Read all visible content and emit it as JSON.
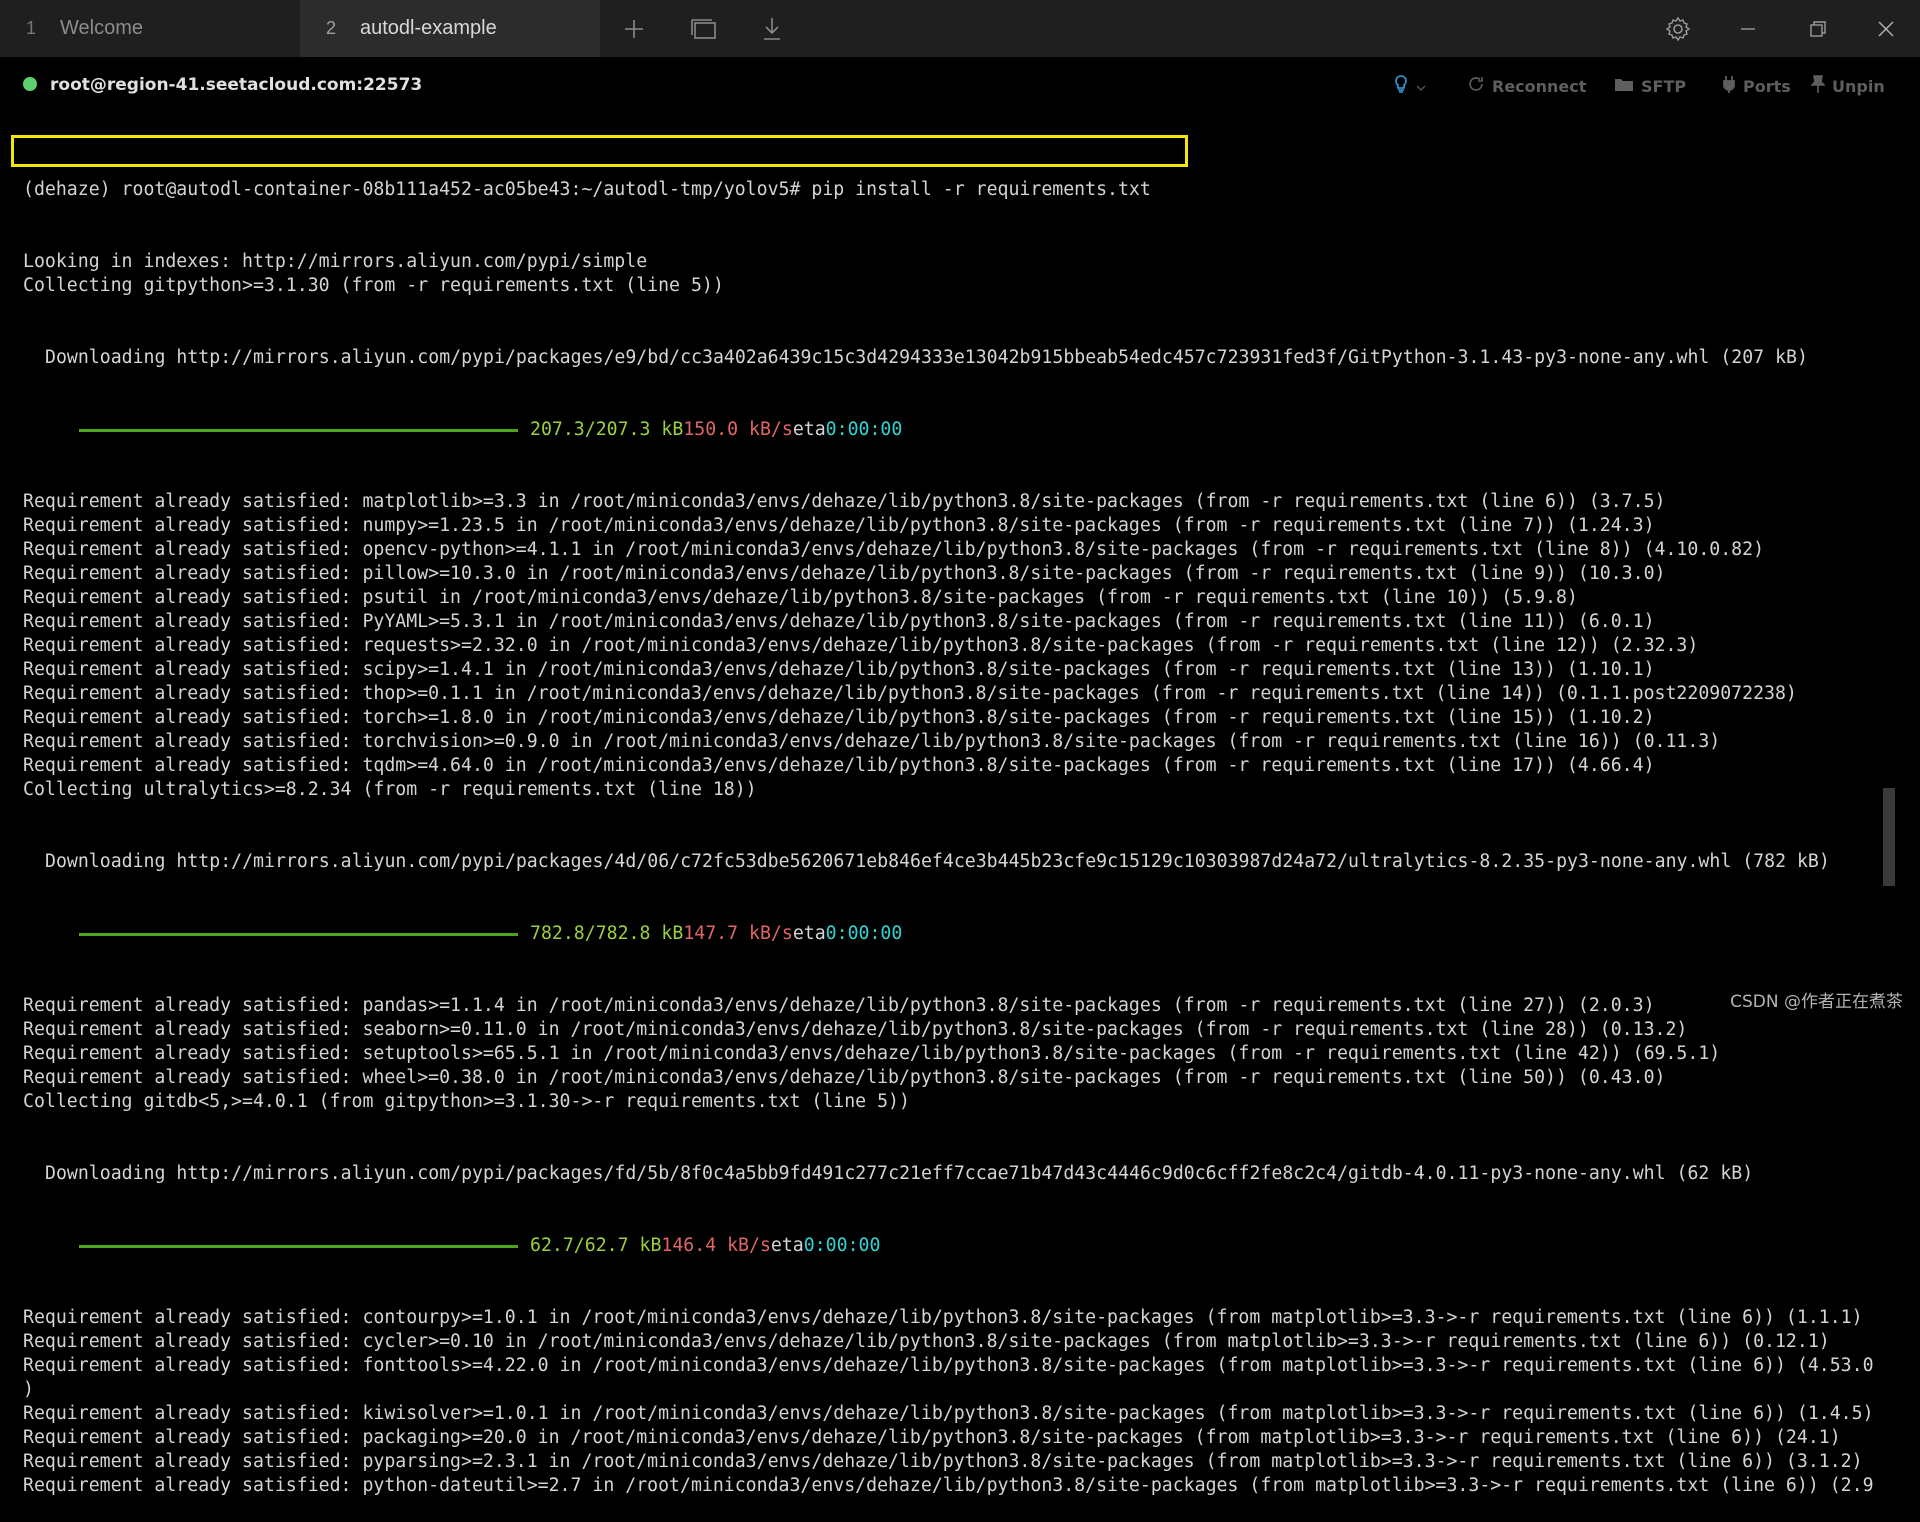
{
  "tabs": [
    {
      "number": "1",
      "label": "Welcome"
    },
    {
      "number": "2",
      "label": "autodl-example"
    }
  ],
  "session": {
    "host": "root@region-41.seetacloud.com:22573",
    "buttons": {
      "reconnect": "Reconnect",
      "sftp": "SFTP",
      "ports": "Ports",
      "unpin": "Unpin"
    }
  },
  "terminal": {
    "command": "(dehaze) root@autodl-container-08b111a452-ac05be43:~/autodl-tmp/yolov5# pip install -r requirements.txt",
    "lines_a": [
      "Looking in indexes: http://mirrors.aliyun.com/pypi/simple",
      "Collecting gitpython>=3.1.30 (from -r requirements.txt (line 5))"
    ],
    "download_1": "Downloading http://mirrors.aliyun.com/pypi/packages/e9/bd/cc3a402a6439c15c3d4294333e13042b915bbeab54edc457c723931fed3f/GitPython-3.1.43-py3-none-any.whl (207 kB)",
    "progress_1": {
      "size": "207.3/207.3 kB",
      "speed": "150.0 kB/s",
      "eta_label": "eta",
      "eta": "0:00:00"
    },
    "lines_b": [
      "Requirement already satisfied: matplotlib>=3.3 in /root/miniconda3/envs/dehaze/lib/python3.8/site-packages (from -r requirements.txt (line 6)) (3.7.5)",
      "Requirement already satisfied: numpy>=1.23.5 in /root/miniconda3/envs/dehaze/lib/python3.8/site-packages (from -r requirements.txt (line 7)) (1.24.3)",
      "Requirement already satisfied: opencv-python>=4.1.1 in /root/miniconda3/envs/dehaze/lib/python3.8/site-packages (from -r requirements.txt (line 8)) (4.10.0.82)",
      "Requirement already satisfied: pillow>=10.3.0 in /root/miniconda3/envs/dehaze/lib/python3.8/site-packages (from -r requirements.txt (line 9)) (10.3.0)",
      "Requirement already satisfied: psutil in /root/miniconda3/envs/dehaze/lib/python3.8/site-packages (from -r requirements.txt (line 10)) (5.9.8)",
      "Requirement already satisfied: PyYAML>=5.3.1 in /root/miniconda3/envs/dehaze/lib/python3.8/site-packages (from -r requirements.txt (line 11)) (6.0.1)",
      "Requirement already satisfied: requests>=2.32.0 in /root/miniconda3/envs/dehaze/lib/python3.8/site-packages (from -r requirements.txt (line 12)) (2.32.3)",
      "Requirement already satisfied: scipy>=1.4.1 in /root/miniconda3/envs/dehaze/lib/python3.8/site-packages (from -r requirements.txt (line 13)) (1.10.1)",
      "Requirement already satisfied: thop>=0.1.1 in /root/miniconda3/envs/dehaze/lib/python3.8/site-packages (from -r requirements.txt (line 14)) (0.1.1.post2209072238)",
      "Requirement already satisfied: torch>=1.8.0 in /root/miniconda3/envs/dehaze/lib/python3.8/site-packages (from -r requirements.txt (line 15)) (1.10.2)",
      "Requirement already satisfied: torchvision>=0.9.0 in /root/miniconda3/envs/dehaze/lib/python3.8/site-packages (from -r requirements.txt (line 16)) (0.11.3)",
      "Requirement already satisfied: tqdm>=4.64.0 in /root/miniconda3/envs/dehaze/lib/python3.8/site-packages (from -r requirements.txt (line 17)) (4.66.4)",
      "Collecting ultralytics>=8.2.34 (from -r requirements.txt (line 18))"
    ],
    "download_2": "Downloading http://mirrors.aliyun.com/pypi/packages/4d/06/c72fc53dbe5620671eb846ef4ce3b445b23cfe9c15129c10303987d24a72/ultralytics-8.2.35-py3-none-any.whl (782 kB)",
    "progress_2": {
      "size": "782.8/782.8 kB",
      "speed": "147.7 kB/s",
      "eta_label": "eta",
      "eta": "0:00:00"
    },
    "lines_c": [
      "Requirement already satisfied: pandas>=1.1.4 in /root/miniconda3/envs/dehaze/lib/python3.8/site-packages (from -r requirements.txt (line 27)) (2.0.3)",
      "Requirement already satisfied: seaborn>=0.11.0 in /root/miniconda3/envs/dehaze/lib/python3.8/site-packages (from -r requirements.txt (line 28)) (0.13.2)",
      "Requirement already satisfied: setuptools>=65.5.1 in /root/miniconda3/envs/dehaze/lib/python3.8/site-packages (from -r requirements.txt (line 42)) (69.5.1)",
      "Requirement already satisfied: wheel>=0.38.0 in /root/miniconda3/envs/dehaze/lib/python3.8/site-packages (from -r requirements.txt (line 50)) (0.43.0)",
      "Collecting gitdb<5,>=4.0.1 (from gitpython>=3.1.30->-r requirements.txt (line 5))"
    ],
    "download_3": "Downloading http://mirrors.aliyun.com/pypi/packages/fd/5b/8f0c4a5bb9fd491c277c21eff7ccae71b47d43c4446c9d0c6cff2fe8c2c4/gitdb-4.0.11-py3-none-any.whl (62 kB)",
    "progress_3": {
      "size": "62.7/62.7 kB",
      "speed": "146.4 kB/s",
      "eta_label": "eta",
      "eta": "0:00:00"
    },
    "lines_d": [
      "Requirement already satisfied: contourpy>=1.0.1 in /root/miniconda3/envs/dehaze/lib/python3.8/site-packages (from matplotlib>=3.3->-r requirements.txt (line 6)) (1.1.1)",
      "Requirement already satisfied: cycler>=0.10 in /root/miniconda3/envs/dehaze/lib/python3.8/site-packages (from matplotlib>=3.3->-r requirements.txt (line 6)) (0.12.1)",
      "Requirement already satisfied: fonttools>=4.22.0 in /root/miniconda3/envs/dehaze/lib/python3.8/site-packages (from matplotlib>=3.3->-r requirements.txt (line 6)) (4.53.0",
      ")",
      "Requirement already satisfied: kiwisolver>=1.0.1 in /root/miniconda3/envs/dehaze/lib/python3.8/site-packages (from matplotlib>=3.3->-r requirements.txt (line 6)) (1.4.5)",
      "Requirement already satisfied: packaging>=20.0 in /root/miniconda3/envs/dehaze/lib/python3.8/site-packages (from matplotlib>=3.3->-r requirements.txt (line 6)) (24.1)",
      "Requirement already satisfied: pyparsing>=2.3.1 in /root/miniconda3/envs/dehaze/lib/python3.8/site-packages (from matplotlib>=3.3->-r requirements.txt (line 6)) (3.1.2)",
      "Requirement already satisfied: python-dateutil>=2.7 in /root/miniconda3/envs/dehaze/lib/python3.8/site-packages (from matplotlib>=3.3->-r requirements.txt (line 6)) (2.9"
    ]
  },
  "watermark": "CSDN @作者正在煮茶",
  "colors": {
    "progress_bar": "#4ea51e",
    "size_text": "#9bd03c",
    "speed_text": "#e06565",
    "eta_text": "#2fd3d3",
    "highlight_box": "#f5e50d",
    "status_dot": "#5bd06b"
  },
  "icons": {
    "new_tab": "plus-icon",
    "window": "window-icon",
    "download": "download-icon",
    "settings": "gear-icon",
    "minimize": "minimize-icon",
    "maximize": "restore-icon",
    "close": "close-icon",
    "tip": "lightbulb-icon",
    "reconnect": "reconnect-icon",
    "sftp": "folder-icon",
    "ports": "plug-icon",
    "unpin": "pin-icon"
  }
}
